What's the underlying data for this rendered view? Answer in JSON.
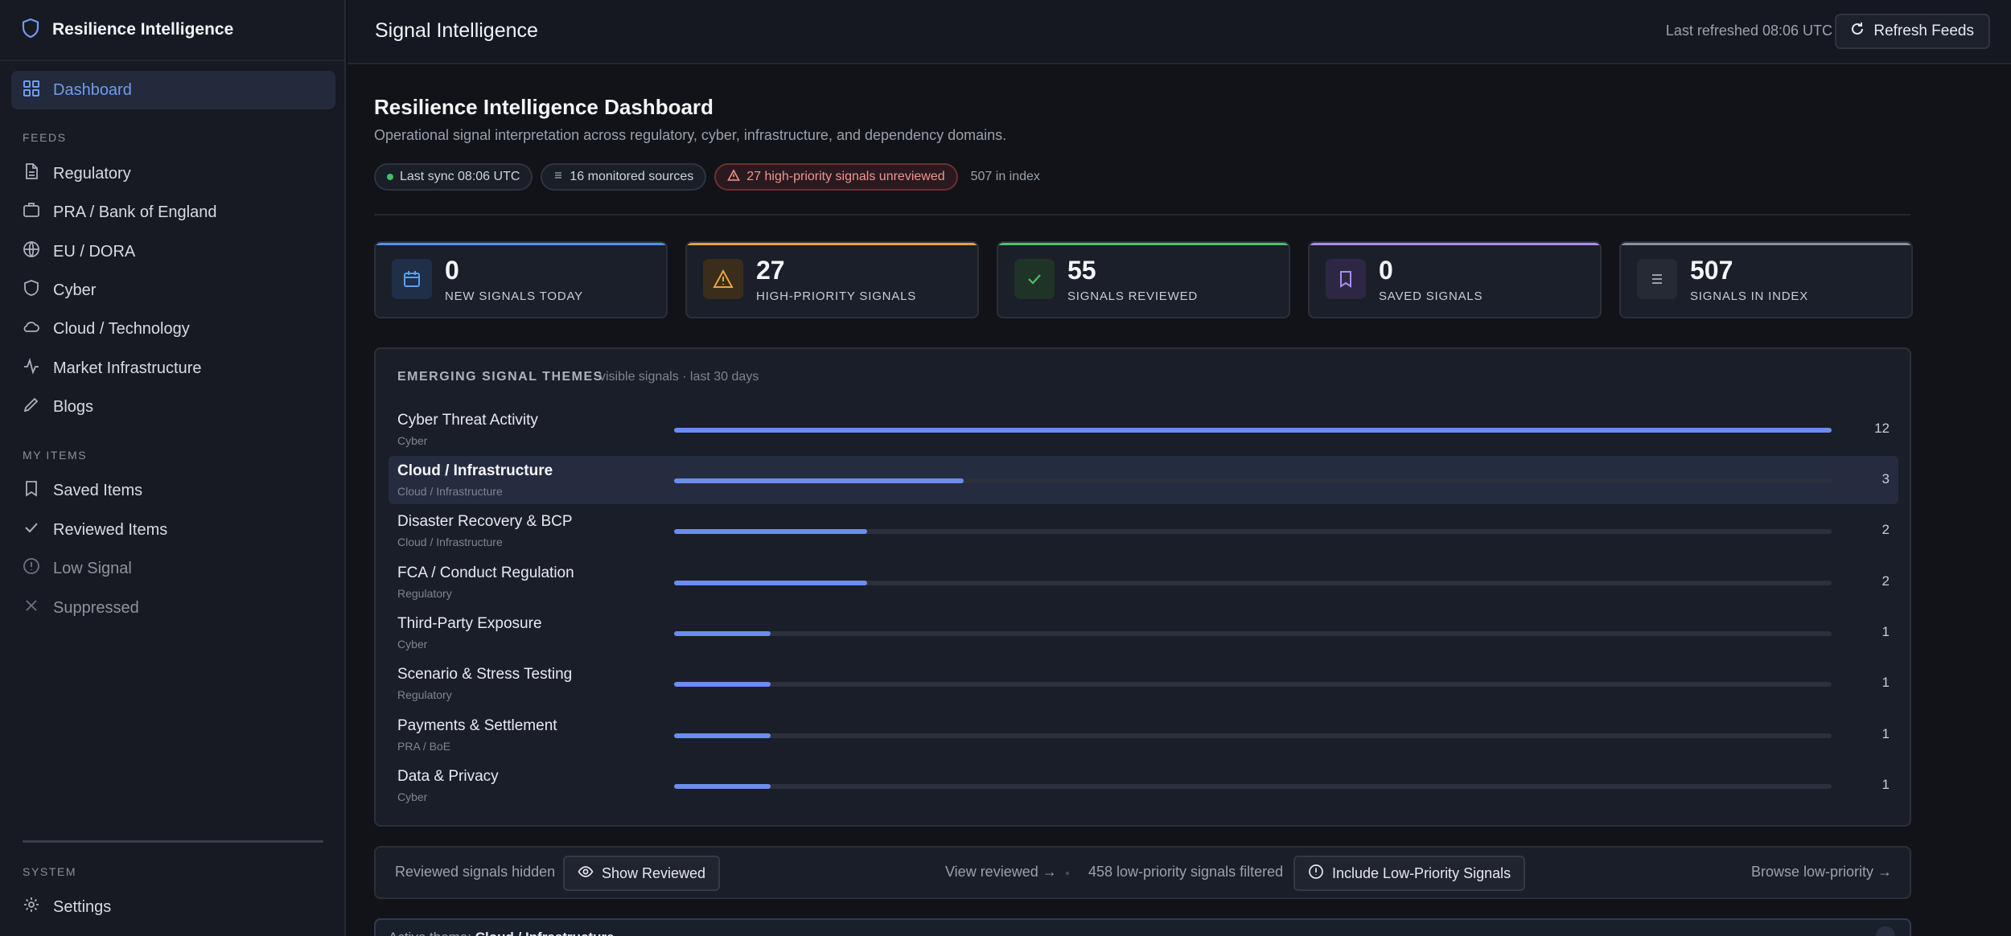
{
  "sidebar": {
    "brand": "Resilience Intelligence",
    "active": {
      "label": "Dashboard",
      "icon": "grid-icon"
    },
    "feeds_label": "FEEDS",
    "feeds": [
      {
        "label": "Regulatory",
        "icon": "document-icon"
      },
      {
        "label": "PRA / Bank of England",
        "icon": "briefcase-icon"
      },
      {
        "label": "EU / DORA",
        "icon": "globe-icon"
      },
      {
        "label": "Cyber",
        "icon": "shield-icon"
      },
      {
        "label": "Cloud / Technology",
        "icon": "cloud-icon"
      },
      {
        "label": "Market Infrastructure",
        "icon": "activity-icon"
      },
      {
        "label": "Blogs",
        "icon": "pen-icon"
      }
    ],
    "my_items_label": "MY ITEMS",
    "my_items": [
      {
        "label": "Saved Items",
        "icon": "bookmark-icon"
      },
      {
        "label": "Reviewed Items",
        "icon": "check-icon"
      },
      {
        "label": "Low Signal",
        "icon": "alert-circle-icon"
      },
      {
        "label": "Suppressed",
        "icon": "x-icon"
      }
    ],
    "system_label": "SYSTEM",
    "settings": {
      "label": "Settings",
      "icon": "gear-icon"
    }
  },
  "header": {
    "title": "Signal Intelligence",
    "last_refreshed": "Last refreshed 08:06 UTC",
    "refresh_label": "Refresh Feeds"
  },
  "dashboard": {
    "title": "Resilience Intelligence Dashboard",
    "subtitle": "Operational signal interpretation across regulatory, cyber, infrastructure, and dependency domains.",
    "chips": {
      "sync": "Last sync 08:06 UTC",
      "sources": "16 monitored sources",
      "warning": "27 high-priority signals unreviewed",
      "index": "507 in index"
    }
  },
  "stats": [
    {
      "value": "0",
      "label": "NEW SIGNALS TODAY",
      "accent": "#4f93e6",
      "icon": "calendar-icon"
    },
    {
      "value": "27",
      "label": "HIGH-PRIORITY SIGNALS",
      "accent": "#e5a13f",
      "icon": "warning-icon"
    },
    {
      "value": "55",
      "label": "SIGNALS REVIEWED",
      "accent": "#4fbf6a",
      "icon": "check-icon"
    },
    {
      "value": "0",
      "label": "SAVED SIGNALS",
      "accent": "#a98cf0",
      "icon": "bookmark-icon"
    },
    {
      "value": "507",
      "label": "SIGNALS IN INDEX",
      "accent": "#8a8f9c",
      "icon": "list-icon"
    }
  ],
  "themes": {
    "title": "EMERGING SIGNAL THEMES",
    "subtitle": "visible signals · last 30 days",
    "max": 12,
    "rows": [
      {
        "name": "Cyber Threat Activity",
        "category": "Cyber",
        "count": 12
      },
      {
        "name": "Cloud / Infrastructure",
        "category": "Cloud / Infrastructure",
        "count": 3,
        "active": true
      },
      {
        "name": "Disaster Recovery & BCP",
        "category": "Cloud / Infrastructure",
        "count": 2
      },
      {
        "name": "FCA / Conduct Regulation",
        "category": "Regulatory",
        "count": 2
      },
      {
        "name": "Third-Party Exposure",
        "category": "Cyber",
        "count": 1
      },
      {
        "name": "Scenario & Stress Testing",
        "category": "Regulatory",
        "count": 1
      },
      {
        "name": "Payments & Settlement",
        "category": "PRA / BoE",
        "count": 1
      },
      {
        "name": "Data & Privacy",
        "category": "Cyber",
        "count": 1
      }
    ]
  },
  "filters": {
    "reviewed_hidden": "Reviewed signals hidden",
    "show_reviewed": "Show Reviewed",
    "view_reviewed": "View reviewed →",
    "low_filtered": "458 low-priority signals filtered",
    "include_low": "Include Low-Priority Signals",
    "browse_low": "Browse low-priority →"
  },
  "active_theme": {
    "prefix": "Active theme:",
    "name": "Cloud / Infrastructure"
  }
}
